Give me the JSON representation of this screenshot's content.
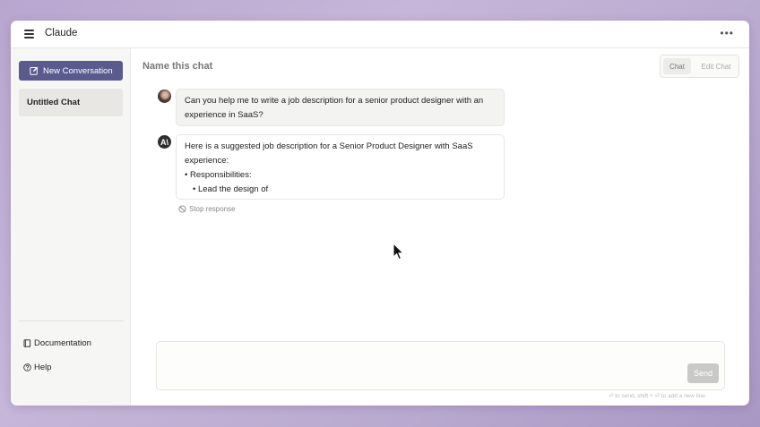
{
  "app": {
    "title": "Claude"
  },
  "sidebar": {
    "new_conversation_label": "New Conversation",
    "chats": [
      {
        "label": "Untitled Chat",
        "selected": true
      }
    ],
    "links": {
      "documentation": "Documentation",
      "help": "Help"
    }
  },
  "main": {
    "chat_name": "Name this chat",
    "modes": {
      "chat": "Chat",
      "edit": "Edit Chat",
      "active": "Chat"
    },
    "messages": [
      {
        "role": "user",
        "avatar": "user-avatar",
        "text": "Can you help me to write a job description for a senior product designer with an experience in SaaS?"
      },
      {
        "role": "assistant",
        "avatar": "claude-logo-icon",
        "avatar_glyph": "A\\",
        "text": "Here is a suggested job description for a Senior Product Designer with SaaS experience:",
        "bullet": "• Responsibilities:",
        "subbullet": "• Lead the design of"
      }
    ],
    "stop_response_label": "Stop response"
  },
  "composer": {
    "value": "",
    "placeholder": "",
    "send_label": "Send",
    "hint": "⏎ to send, shift + ⏎ to add a new line"
  },
  "colors": {
    "accent": "#5b5a8e",
    "background_gradient_start": "#b9a6cf",
    "send_disabled": "#c9c9c7"
  }
}
